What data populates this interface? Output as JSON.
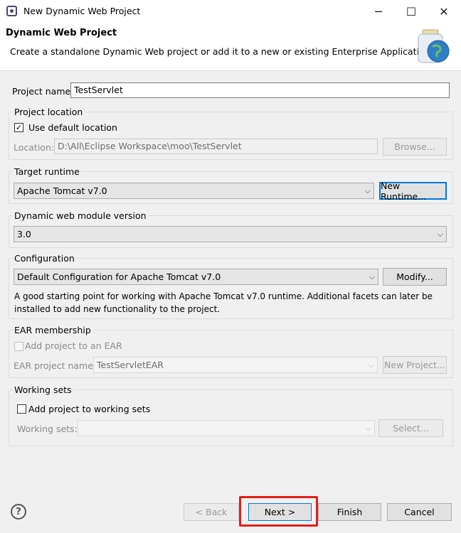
{
  "window": {
    "title": "New Dynamic Web Project",
    "minimize": "─",
    "maximize": "☐",
    "close": "✕"
  },
  "banner": {
    "title": "Dynamic Web Project",
    "description": "Create a standalone Dynamic Web project or add it to a new or existing Enterprise Application."
  },
  "project_name": {
    "label": "Project name:",
    "value": "TestServlet"
  },
  "project_location": {
    "group": "Project location",
    "use_default_label": "Use default location",
    "use_default_checked": true,
    "location_label": "Location:",
    "location_value": "D:\\All\\Eclipse Workspace\\moo\\TestServlet",
    "browse": "Browse..."
  },
  "target_runtime": {
    "group": "Target runtime",
    "value": "Apache Tomcat v7.0",
    "new_runtime": "New Runtime..."
  },
  "module_version": {
    "group": "Dynamic web module version",
    "value": "3.0"
  },
  "configuration": {
    "group": "Configuration",
    "value": "Default Configuration for Apache Tomcat v7.0",
    "modify": "Modify...",
    "desc_line1": "A good starting point for working with Apache Tomcat v7.0 runtime. Additional facets can later be",
    "desc_line2": "installed to add new functionality to the project."
  },
  "ear": {
    "group": "EAR membership",
    "add_label": "Add project to an EAR",
    "ear_name_label": "EAR project name:",
    "ear_name_value": "TestServletEAR",
    "new_project": "New Project..."
  },
  "working_sets": {
    "group": "Working sets",
    "add_label": "Add project to working sets",
    "label": "Working sets:",
    "value": "",
    "select": "Select..."
  },
  "footer": {
    "back": "< Back",
    "next": "Next >",
    "finish": "Finish",
    "cancel": "Cancel",
    "help": "?"
  }
}
